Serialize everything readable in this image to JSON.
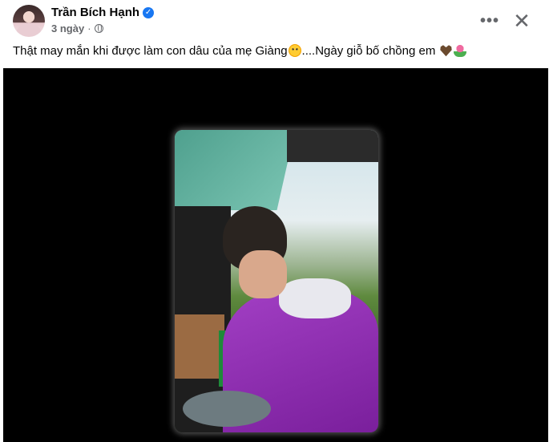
{
  "post": {
    "author": "Trần Bích Hạnh",
    "verified_mark": "✓",
    "time": "3 ngày",
    "separator": "·",
    "text_part1": "Thật may mắn khi được làm con dâu của mẹ Giàng",
    "text_part2": "....Ngày giỗ bố chồng em",
    "emojis": [
      "smiling-face-with-hearts",
      "brown-heart",
      "tulip"
    ]
  },
  "controls": {
    "more_label": "•••",
    "close_label": "✕"
  },
  "icons": {
    "privacy": "globe-icon",
    "verified": "verified-badge-icon"
  },
  "colors": {
    "accent": "#1877f2",
    "secondary_text": "#65676b",
    "video_bg": "#000000"
  }
}
